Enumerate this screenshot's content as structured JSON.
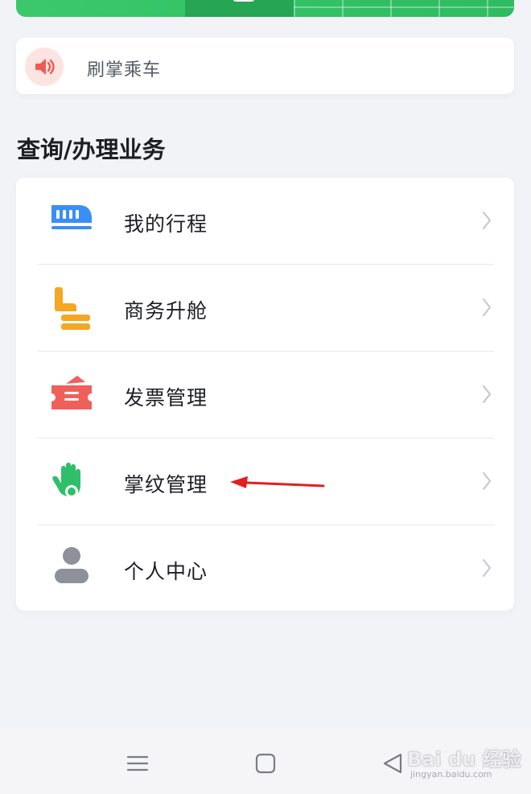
{
  "notice": {
    "icon": "speaker-icon",
    "text": "刷掌乘车"
  },
  "section": {
    "title": "查询/办理业务"
  },
  "menu": {
    "items": [
      {
        "label": "我的行程",
        "icon": "train-icon",
        "color": "#3a8ef6"
      },
      {
        "label": "商务升舱",
        "icon": "seat-icon",
        "color": "#f5a623"
      },
      {
        "label": "发票管理",
        "icon": "ticket-icon",
        "color": "#f0605a"
      },
      {
        "label": "掌纹管理",
        "icon": "palm-icon",
        "color": "#2fbf6b"
      },
      {
        "label": "个人中心",
        "icon": "person-icon",
        "color": "#8e9199"
      }
    ]
  },
  "annotation": {
    "color": "#e02020"
  },
  "navbar": {
    "buttons": [
      "menu-icon",
      "home-icon",
      "back-icon"
    ]
  },
  "watermark": {
    "main": "Bai du 经验",
    "sub": "jingyan.baidu.com"
  },
  "colors": {
    "banner_green": "#35c467",
    "background": "#f2f3f7"
  }
}
